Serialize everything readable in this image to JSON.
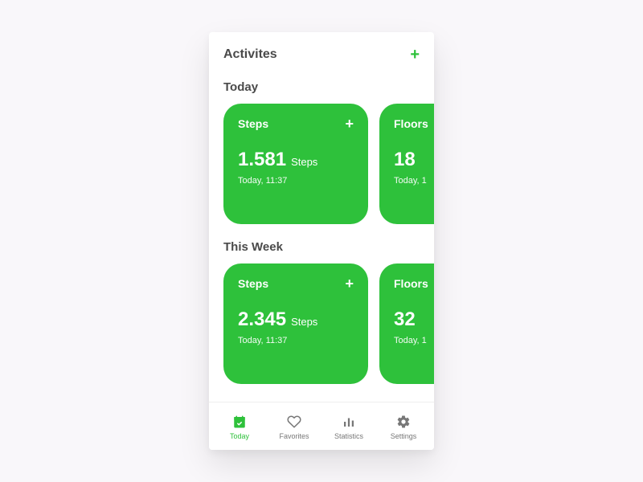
{
  "header": {
    "title": "Activites"
  },
  "sections": {
    "today": {
      "title": "Today",
      "cards": [
        {
          "title": "Steps",
          "value": "1.581",
          "unit": "Steps",
          "time": "Today, 11:37"
        },
        {
          "title": "Floors",
          "value": "18",
          "unit": "",
          "time": "Today, 1"
        }
      ]
    },
    "thisWeek": {
      "title": "This Week",
      "cards": [
        {
          "title": "Steps",
          "value": "2.345",
          "unit": "Steps",
          "time": "Today, 11:37"
        },
        {
          "title": "Floors",
          "value": "32",
          "unit": "",
          "time": "Today, 1"
        }
      ]
    }
  },
  "tabs": {
    "today": "Today",
    "favorites": "Favorites",
    "statistics": "Statistics",
    "settings": "Settings"
  },
  "colors": {
    "accent": "#2ec13b"
  }
}
